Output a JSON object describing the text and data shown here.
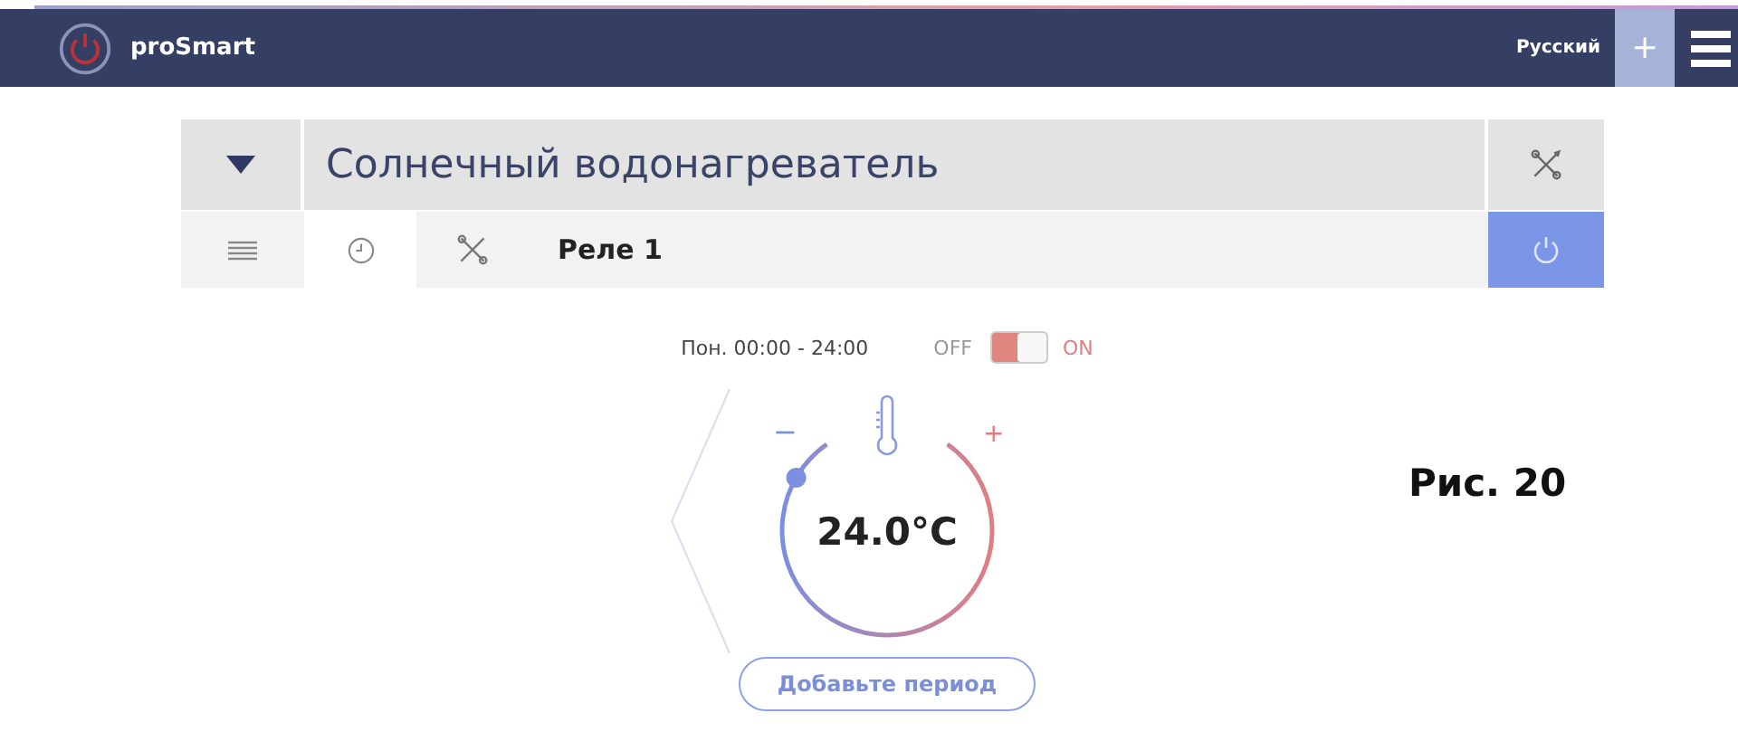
{
  "header": {
    "logo_text": "proSmart",
    "language": "Русский",
    "add_label": "+"
  },
  "device": {
    "name": "Солнечный водонагреватель",
    "expanded": true
  },
  "tabs": [
    {
      "kind": "list",
      "selected": false
    },
    {
      "kind": "clock",
      "selected": true
    },
    {
      "kind": "tools",
      "selected": false
    }
  ],
  "relay": {
    "name": "Реле 1",
    "power_on": true
  },
  "schedule": {
    "period": "Пон. 00:00 - 24:00",
    "off_label": "OFF",
    "on_label": "ON",
    "on": true
  },
  "thermostat": {
    "minus": "−",
    "plus": "+",
    "temperature": "24.0°C"
  },
  "add_period_button": "Добавьте период",
  "caption": "Рис. 20"
}
